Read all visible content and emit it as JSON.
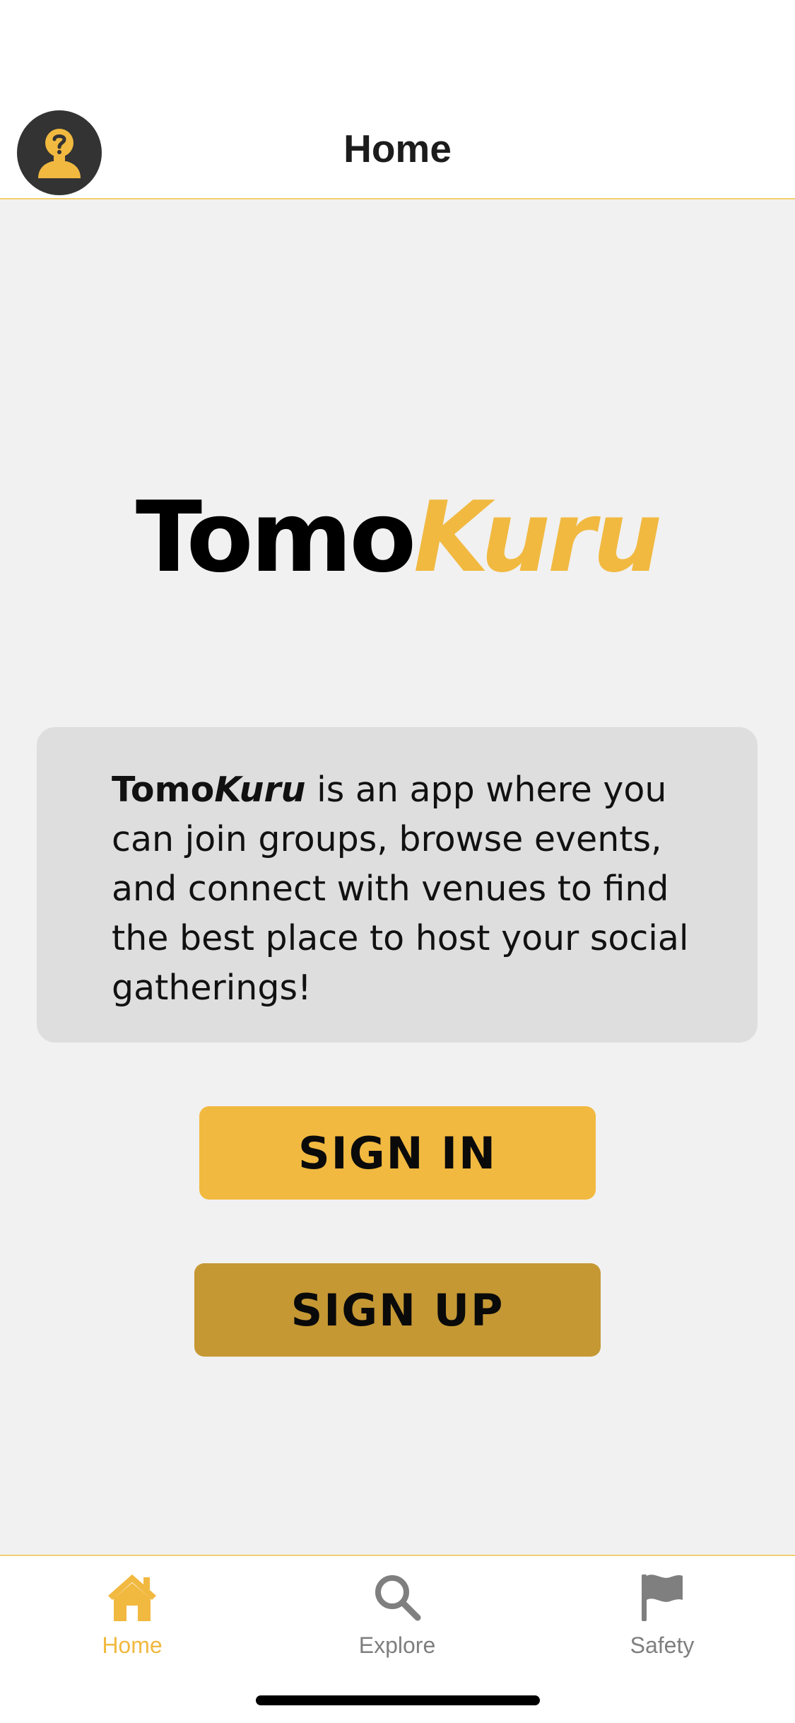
{
  "header": {
    "title": "Home",
    "avatar_icon": "unknown-user-icon"
  },
  "logo": {
    "part_a": "Tomo",
    "part_b": "Kuru"
  },
  "info": {
    "brand_a": "Tomo",
    "brand_b": "Kuru",
    "text": " is an app where you can join groups, browse events, and connect with venues to find the best place to host your social gatherings!"
  },
  "buttons": {
    "sign_in": "SIGN IN",
    "sign_up": "SIGN UP"
  },
  "tabbar": {
    "items": [
      {
        "label": "Home",
        "icon": "home-icon",
        "active": true
      },
      {
        "label": "Explore",
        "icon": "search-icon",
        "active": false
      },
      {
        "label": "Safety",
        "icon": "flag-icon",
        "active": false
      }
    ]
  },
  "colors": {
    "accent": "#f1b940",
    "accent_dark": "#c59834",
    "background": "#f1f1f1",
    "card": "#dedede",
    "inactive": "#7f7f7f"
  }
}
